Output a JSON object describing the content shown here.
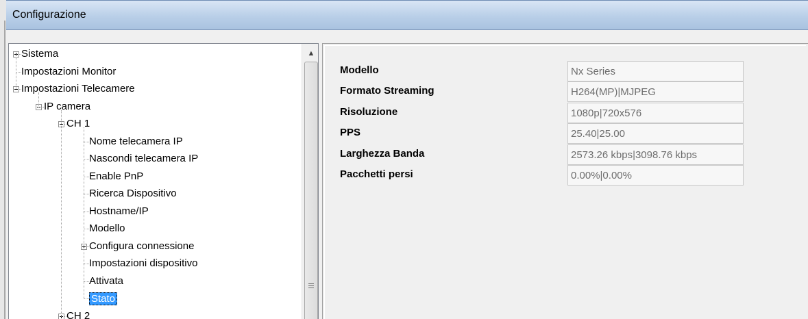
{
  "window": {
    "title": "Configurazione"
  },
  "tree": {
    "items": [
      {
        "label": "Sistema",
        "level": 0,
        "expander": "plus"
      },
      {
        "label": "Impostazioni Monitor",
        "level": 0,
        "expander": "none"
      },
      {
        "label": "Impostazioni Telecamere",
        "level": 0,
        "expander": "minus"
      },
      {
        "label": "IP camera",
        "level": 1,
        "expander": "minus"
      },
      {
        "label": "CH 1",
        "level": 2,
        "expander": "minus"
      },
      {
        "label": "Nome telecamera IP",
        "level": 3,
        "expander": "none"
      },
      {
        "label": "Nascondi telecamera IP",
        "level": 3,
        "expander": "none"
      },
      {
        "label": "Enable PnP",
        "level": 3,
        "expander": "none"
      },
      {
        "label": "Ricerca Dispositivo",
        "level": 3,
        "expander": "none"
      },
      {
        "label": "Hostname/IP",
        "level": 3,
        "expander": "none"
      },
      {
        "label": "Modello",
        "level": 3,
        "expander": "none"
      },
      {
        "label": "Configura connessione",
        "level": 3,
        "expander": "plus"
      },
      {
        "label": "Impostazioni dispositivo",
        "level": 3,
        "expander": "none"
      },
      {
        "label": "Attivata",
        "level": 3,
        "expander": "none"
      },
      {
        "label": "Stato",
        "level": 3,
        "expander": "none",
        "selected": true
      },
      {
        "label": "CH 2",
        "level": 2,
        "expander": "plus"
      }
    ]
  },
  "status": {
    "rows": [
      {
        "label": "Modello",
        "value": "Nx Series"
      },
      {
        "label": "Formato Streaming",
        "value": "H264(MP)|MJPEG"
      },
      {
        "label": "Risoluzione",
        "value": "1080p|720x576"
      },
      {
        "label": "PPS",
        "value": "25.40|25.00"
      },
      {
        "label": "Larghezza Banda",
        "value": "2573.26 kbps|3098.76 kbps"
      },
      {
        "label": "Pacchetti persi",
        "value": "0.00%|0.00%"
      }
    ]
  },
  "colors": {
    "selection": "#3399ff",
    "title_gradient_top": "#d9e6f5",
    "title_gradient_bottom": "#a9c2e0"
  }
}
